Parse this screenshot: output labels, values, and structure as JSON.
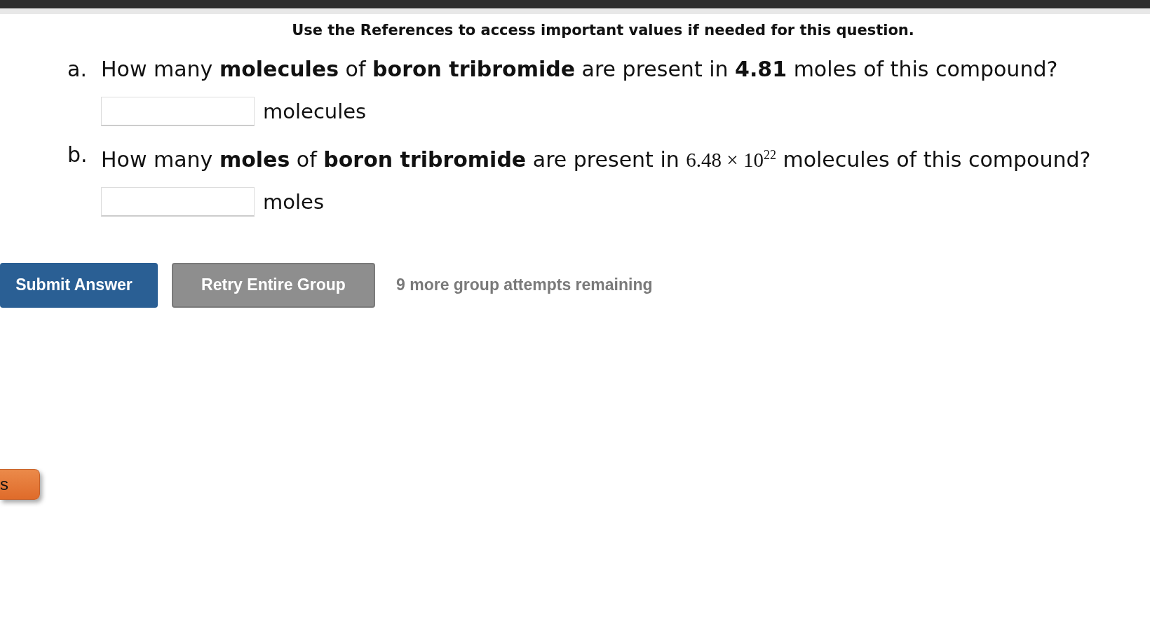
{
  "instruction": "Use the References to access important values if needed for this question.",
  "questions": [
    {
      "label": "a.",
      "segments": [
        {
          "kind": "text",
          "text": "How many **molecules** of **boron tribromide** are present in **4.81** moles of this compound?"
        }
      ],
      "unit": "molecules"
    },
    {
      "label": "b.",
      "segments": [
        {
          "kind": "text",
          "text": "How many **moles** of **boron tribromide** are present in"
        },
        {
          "kind": "math",
          "text": "6.48 × 10$^{22}$"
        },
        {
          "kind": "text",
          "text": "molecules of this compound?"
        }
      ],
      "unit": "moles"
    }
  ],
  "buttons": [
    {
      "label": "Submit Answer",
      "kind": "primary"
    },
    {
      "label": "Retry Entire Group",
      "kind": "secondary"
    }
  ],
  "attempts": "9 more group attempts remaining",
  "side_button": {
    "label": "s"
  }
}
